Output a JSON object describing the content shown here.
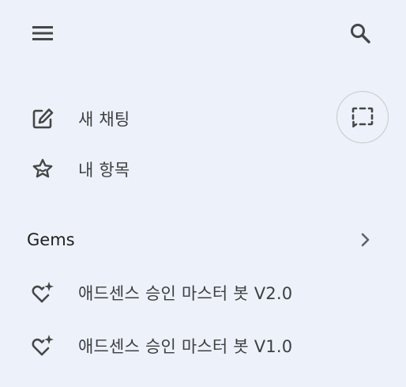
{
  "header": {
    "menu_icon": "hamburger-menu-icon",
    "search_icon": "search-icon"
  },
  "nav": {
    "new_chat": {
      "label": "새 채팅",
      "icon": "edit-pencil-icon"
    },
    "my_items": {
      "label": "내 항목",
      "icon": "star-icon"
    },
    "temp_chat_icon": "dashed-chat-bubble-icon"
  },
  "gems": {
    "title": "Gems",
    "chevron_icon": "chevron-right-icon",
    "items": [
      {
        "label": "애드센스 승인 마스터 봇 V2.0",
        "icon": "gem-heart-sparkle-icon"
      },
      {
        "label": "애드센스 승인 마스터 봇 V1.0",
        "icon": "gem-heart-sparkle-icon"
      }
    ]
  },
  "colors": {
    "background": "#edf1f9",
    "icon": "#444746",
    "text": "#1f1f1f"
  }
}
